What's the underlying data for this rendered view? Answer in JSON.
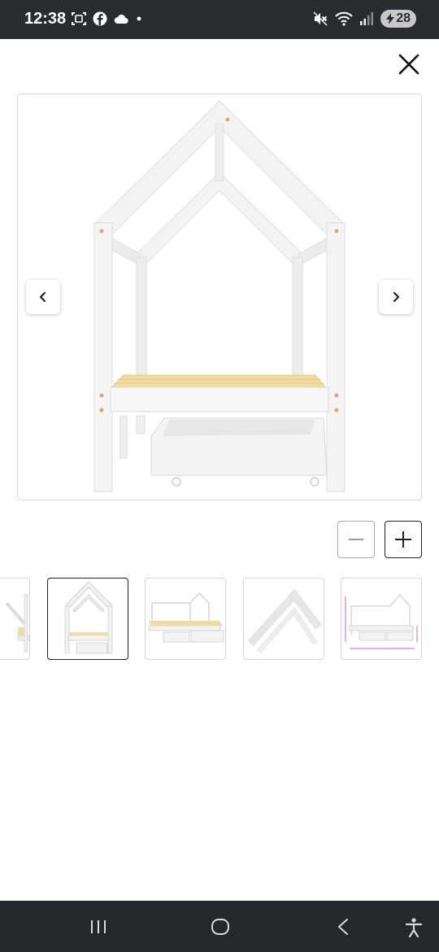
{
  "status_bar": {
    "time": "12:38",
    "battery_level": "28",
    "icons_left": [
      "screenshot-icon",
      "facebook-icon",
      "cloud-icon",
      "dot-icon"
    ],
    "icons_right": [
      "mute-icon",
      "wifi-icon",
      "signal-icon",
      "battery-icon"
    ]
  },
  "viewer": {
    "close_icon": "close-icon",
    "prev_icon": "chevron-left-icon",
    "next_icon": "chevron-right-icon",
    "zoom_out_icon": "minus-icon",
    "zoom_in_icon": "plus-icon",
    "selected_thumbnail": 1,
    "thumbnails": [
      {
        "view": "partial-side-view"
      },
      {
        "view": "front-view"
      },
      {
        "view": "angled-view-with-drawers"
      },
      {
        "view": "roof-detail"
      },
      {
        "view": "dimensions-diagram"
      }
    ]
  },
  "nav_bar": {
    "icons": [
      "recent-apps-icon",
      "home-icon",
      "back-icon",
      "accessibility-icon"
    ]
  },
  "colors": {
    "status_bar_bg": "#2a2b2e",
    "nav_bar_bg": "#26272a",
    "bed_white": "#f2f2f2",
    "slat_wood": "#f1dca0",
    "dimension_pink": "#c06ab8"
  }
}
